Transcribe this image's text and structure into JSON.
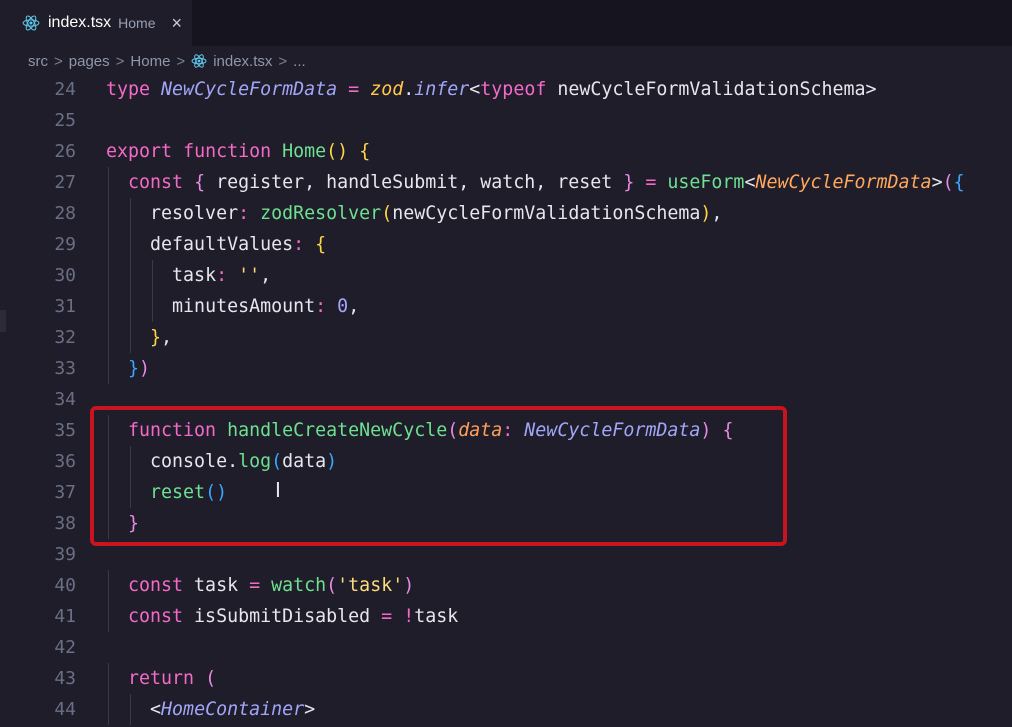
{
  "tab": {
    "file": "index.tsx",
    "dir": "Home",
    "close": "×",
    "icon": "react-icon"
  },
  "breadcrumb": {
    "items": [
      "src",
      "pages",
      "Home",
      "index.tsx",
      "..."
    ],
    "separator": ">"
  },
  "code_lines": [
    {
      "num": "24",
      "tokens": [
        [
          "type",
          "kw"
        ],
        [
          " ",
          ""
        ],
        [
          "NewCycleFormData",
          "ty"
        ],
        [
          " ",
          ""
        ],
        [
          "=",
          "op"
        ],
        [
          " ",
          ""
        ],
        [
          "zod",
          "zod"
        ],
        [
          ".",
          ""
        ],
        [
          "infer",
          "ty"
        ],
        [
          "<",
          ""
        ],
        [
          "typeof",
          "kw"
        ],
        [
          " ",
          ""
        ],
        [
          "newCycleFormValidationSchema",
          ""
        ],
        [
          ">",
          ""
        ]
      ]
    },
    {
      "num": "25",
      "tokens": []
    },
    {
      "num": "26",
      "tokens": [
        [
          "export",
          "kw"
        ],
        [
          " ",
          ""
        ],
        [
          "function",
          "kw"
        ],
        [
          " ",
          ""
        ],
        [
          "Home",
          "fn"
        ],
        [
          "()",
          "b1"
        ],
        [
          " ",
          ""
        ],
        [
          "{",
          "b1"
        ]
      ]
    },
    {
      "num": "27",
      "tokens": [
        [
          "  ",
          ""
        ],
        [
          "const",
          "kw"
        ],
        [
          " ",
          ""
        ],
        [
          "{",
          "b2"
        ],
        [
          " register, handleSubmit, watch, reset ",
          ""
        ],
        [
          "}",
          "b2"
        ],
        [
          " ",
          ""
        ],
        [
          "=",
          "op"
        ],
        [
          " ",
          ""
        ],
        [
          "useForm",
          "fn"
        ],
        [
          "<",
          ""
        ],
        [
          "NewCycleFormData",
          "ge"
        ],
        [
          ">",
          ""
        ],
        [
          "(",
          "b2"
        ],
        [
          "{",
          "b3"
        ]
      ]
    },
    {
      "num": "28",
      "tokens": [
        [
          "    ",
          ""
        ],
        [
          "resolver",
          ""
        ],
        [
          ":",
          "op"
        ],
        [
          " ",
          ""
        ],
        [
          "zodResolver",
          "fn"
        ],
        [
          "(",
          "b1"
        ],
        [
          "newCycleFormValidationSchema",
          ""
        ],
        [
          ")",
          "b1"
        ],
        [
          ",",
          ""
        ]
      ]
    },
    {
      "num": "29",
      "tokens": [
        [
          "    ",
          ""
        ],
        [
          "defaultValues",
          ""
        ],
        [
          ":",
          "op"
        ],
        [
          " ",
          ""
        ],
        [
          "{",
          "b1"
        ]
      ]
    },
    {
      "num": "30",
      "tokens": [
        [
          "      ",
          ""
        ],
        [
          "task",
          ""
        ],
        [
          ":",
          "op"
        ],
        [
          " ",
          ""
        ],
        [
          "''",
          "str"
        ],
        [
          ",",
          ""
        ]
      ]
    },
    {
      "num": "31",
      "tokens": [
        [
          "      ",
          ""
        ],
        [
          "minutesAmount",
          ""
        ],
        [
          ":",
          "op"
        ],
        [
          " ",
          ""
        ],
        [
          "0",
          "num"
        ],
        [
          ",",
          ""
        ]
      ]
    },
    {
      "num": "32",
      "tokens": [
        [
          "    ",
          ""
        ],
        [
          "}",
          "b1"
        ],
        [
          ",",
          ""
        ]
      ]
    },
    {
      "num": "33",
      "tokens": [
        [
          "  ",
          ""
        ],
        [
          "}",
          "b3"
        ],
        [
          ")",
          "b2"
        ]
      ]
    },
    {
      "num": "34",
      "tokens": []
    },
    {
      "num": "35",
      "tokens": [
        [
          "  ",
          ""
        ],
        [
          "function",
          "kw"
        ],
        [
          " ",
          ""
        ],
        [
          "handleCreateNewCycle",
          "fn"
        ],
        [
          "(",
          "b2"
        ],
        [
          "data",
          "pa"
        ],
        [
          ":",
          "op"
        ],
        [
          " ",
          ""
        ],
        [
          "NewCycleFormData",
          "ty"
        ],
        [
          ")",
          "b2"
        ],
        [
          " ",
          ""
        ],
        [
          "{",
          "b2"
        ]
      ]
    },
    {
      "num": "36",
      "tokens": [
        [
          "    ",
          ""
        ],
        [
          "console",
          ""
        ],
        [
          ".",
          ""
        ],
        [
          "log",
          "fn"
        ],
        [
          "(",
          "b3"
        ],
        [
          "data",
          ""
        ],
        [
          ")",
          "b3"
        ]
      ]
    },
    {
      "num": "37",
      "tokens": [
        [
          "    ",
          ""
        ],
        [
          "reset",
          "fn"
        ],
        [
          "()",
          "b3"
        ]
      ]
    },
    {
      "num": "38",
      "tokens": [
        [
          "  ",
          ""
        ],
        [
          "}",
          "b2"
        ]
      ]
    },
    {
      "num": "39",
      "tokens": []
    },
    {
      "num": "40",
      "tokens": [
        [
          "  ",
          ""
        ],
        [
          "const",
          "kw"
        ],
        [
          " task ",
          ""
        ],
        [
          "=",
          "op"
        ],
        [
          " ",
          ""
        ],
        [
          "watch",
          "fn"
        ],
        [
          "(",
          "b2"
        ],
        [
          "'task'",
          "str"
        ],
        [
          ")",
          "b2"
        ]
      ]
    },
    {
      "num": "41",
      "tokens": [
        [
          "  ",
          ""
        ],
        [
          "const",
          "kw"
        ],
        [
          " isSubmitDisabled ",
          ""
        ],
        [
          "=",
          "op"
        ],
        [
          " ",
          ""
        ],
        [
          "!",
          "op"
        ],
        [
          "task",
          ""
        ]
      ]
    },
    {
      "num": "42",
      "tokens": []
    },
    {
      "num": "43",
      "tokens": [
        [
          "  ",
          ""
        ],
        [
          "return",
          "kw"
        ],
        [
          " ",
          ""
        ],
        [
          "(",
          "b2"
        ]
      ]
    },
    {
      "num": "44",
      "tokens": [
        [
          "    ",
          ""
        ],
        [
          "<",
          ""
        ],
        [
          "HomeContainer",
          "ty"
        ],
        [
          ">",
          ""
        ]
      ]
    }
  ],
  "highlight": {
    "color": "#c8141e",
    "lines": [
      "35",
      "38"
    ]
  }
}
